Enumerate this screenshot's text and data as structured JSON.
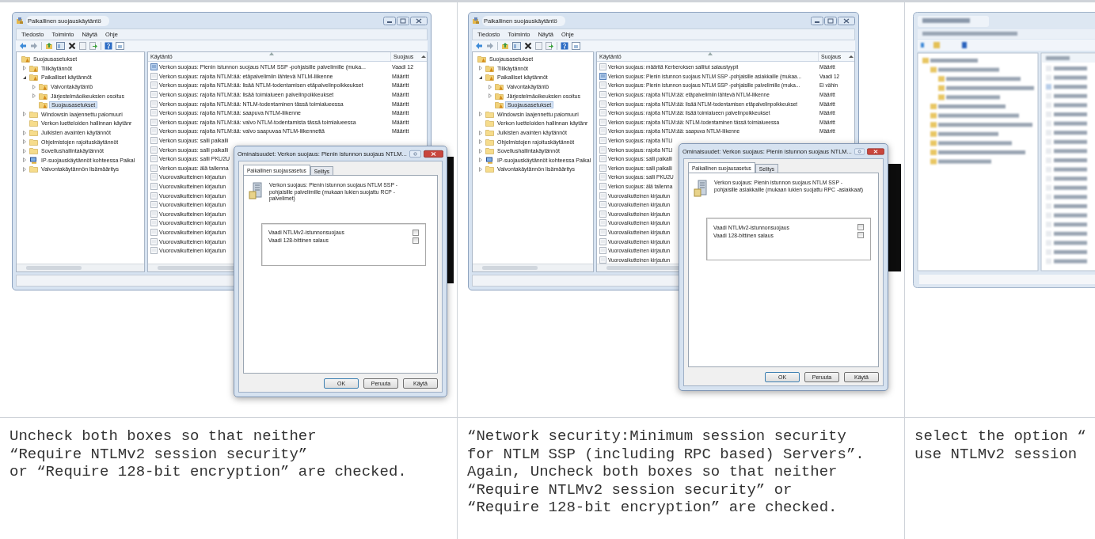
{
  "columns": [
    {
      "screenshot": {
        "kind": "window",
        "title": "Paikallinen suojauskäytäntö",
        "menu": [
          "Tiedosto",
          "Toiminto",
          "Näytä",
          "Ohje"
        ],
        "tree": [
          {
            "label": "Suojausasetukset",
            "kind": "secure-folder",
            "selected": false,
            "children": [
              {
                "label": "Tilikäytännöt",
                "kind": "secure-folder",
                "expanded": false,
                "selected": false
              },
              {
                "label": "Paikalliset käytännöt",
                "kind": "secure-folder",
                "expanded": true,
                "selected": false,
                "children": [
                  {
                    "label": "Valvontakäytäntö",
                    "kind": "secure-folder",
                    "expanded": false,
                    "selected": false
                  },
                  {
                    "label": "Järjestelmäoikeuksien osoitus",
                    "kind": "secure-folder",
                    "expanded": false,
                    "selected": false
                  },
                  {
                    "label": "Suojausasetukset",
                    "kind": "secure-folder",
                    "selected": true
                  }
                ]
              },
              {
                "label": "Windowsin laajennettu palomuuri",
                "kind": "folder",
                "expanded": false,
                "selected": false
              },
              {
                "label": "Verkon luetteloiden hallinnan käytänr",
                "kind": "folder",
                "selected": false
              },
              {
                "label": "Julkisten avainten käytännöt",
                "kind": "folder",
                "expanded": false,
                "selected": false
              },
              {
                "label": "Ohjelmistojen rajoituskäytännöt",
                "kind": "folder",
                "expanded": false,
                "selected": false
              },
              {
                "label": "Sovellushallintakäytännöt",
                "kind": "folder",
                "expanded": false,
                "selected": false
              },
              {
                "label": "IP-suojauskäytännöt kohteessa Paikal",
                "kind": "computer",
                "expanded": false,
                "selected": false
              },
              {
                "label": "Valvontakäytännön lisämääritys",
                "kind": "folder",
                "expanded": false,
                "selected": false
              }
            ]
          }
        ],
        "list": {
          "columns": [
            "Käytäntö",
            "Suojaus"
          ],
          "rows": [
            {
              "policy": "Verkon suojaus: Pienin istunnon suojaus NTLM SSP -pohjaisille palvelimille (muka...",
              "setting": "Vaadi 12",
              "highlighted": true
            },
            {
              "policy": "Verkon suojaus: rajoita NTLM:ää: etäpalvelimiin lähtevä NTLM-liikenne",
              "setting": "Määritt",
              "highlighted": false
            },
            {
              "policy": "Verkon suojaus: rajoita NTLM:ää: lisää NTLM-todentamisen etäpalvelinpoikkeukset",
              "setting": "Määritt",
              "highlighted": false
            },
            {
              "policy": "Verkon suojaus: rajoita NTLM:ää: lisää toimialueen palvelinpoikkeukset",
              "setting": "Määritt",
              "highlighted": false
            },
            {
              "policy": "Verkon suojaus: rajoita NTLM:ää: NTLM-todentaminen tässä toimialueessa",
              "setting": "Määritt",
              "highlighted": false
            },
            {
              "policy": "Verkon suojaus: rajoita NTLM:ää: saapuva NTLM-liikenne",
              "setting": "Määritt",
              "highlighted": false
            },
            {
              "policy": "Verkon suojaus: rajoita NTLM:ää: valvo NTLM-todentamista tässä toimialueessa",
              "setting": "Määritt",
              "highlighted": false
            },
            {
              "policy": "Verkon suojaus: rajoita NTLM:ää: valvo saapuvaa NTLM-liikennettä",
              "setting": "Määritt",
              "highlighted": false
            },
            {
              "policy": "Verkon suojaus: salli paikalli",
              "highlighted": false
            },
            {
              "policy": "Verkon suojaus: salli paikalli",
              "highlighted": false
            },
            {
              "policy": "Verkon suojaus: salli PKU2U",
              "highlighted": false
            },
            {
              "policy": "Verkon suojaus: älä tallenna",
              "highlighted": false
            },
            {
              "policy": "Vuorovaikutteinen kirjautun",
              "highlighted": false
            },
            {
              "policy": "Vuorovaikutteinen kirjautun",
              "highlighted": false
            },
            {
              "policy": "Vuorovaikutteinen kirjautun",
              "highlighted": false
            },
            {
              "policy": "Vuorovaikutteinen kirjautun",
              "highlighted": false
            },
            {
              "policy": "Vuorovaikutteinen kirjautun",
              "highlighted": false
            },
            {
              "policy": "Vuorovaikutteinen kirjautun",
              "highlighted": false
            },
            {
              "policy": "Vuorovaikutteinen kirjautun",
              "highlighted": false
            },
            {
              "policy": "Vuorovaikutteinen kirjautun",
              "highlighted": false
            },
            {
              "policy": "Vuorovaikutteinen kirjautun",
              "highlighted": false
            }
          ]
        },
        "console": true,
        "dialog": {
          "title": "Ominaisuudet: Verkon suojaus: Pienin istunnon suojaus NTLM...",
          "tabs": [
            {
              "label": "Paikallinen suojausasetus",
              "selected": true
            },
            {
              "label": "Selitys",
              "selected": false
            }
          ],
          "description": "Verkon suojaus: Pienin istunnon suojaus NTLM SSP -pohjaisille palvelimille (mukaan lukien suojattu RCP -palvelimet)",
          "options": [
            {
              "label": "Vaadi NTLMv2-istunnonsuojaus",
              "checked": false
            },
            {
              "label": "Vaadi 128-bittinen salaus",
              "checked": false
            }
          ],
          "buttons": [
            "OK",
            "Peruuta",
            "Käytä"
          ]
        }
      },
      "caption": "Uncheck both boxes so that neither\n“Require NTLMv2 session security”\nor “Require 128-bit encryption” are checked."
    },
    {
      "screenshot": {
        "kind": "window",
        "title": "Paikallinen suojauskäytäntö",
        "menu": [
          "Tiedosto",
          "Toiminto",
          "Näytä",
          "Ohje"
        ],
        "tree": [
          {
            "label": "Suojausasetukset",
            "kind": "secure-folder",
            "selected": false,
            "children": [
              {
                "label": "Tilikäytännöt",
                "kind": "secure-folder",
                "expanded": false,
                "selected": false
              },
              {
                "label": "Paikalliset käytännöt",
                "kind": "secure-folder",
                "expanded": true,
                "selected": false,
                "children": [
                  {
                    "label": "Valvontakäytäntö",
                    "kind": "secure-folder",
                    "expanded": false,
                    "selected": false
                  },
                  {
                    "label": "Järjestelmäoikeuksien osoitus",
                    "kind": "secure-folder",
                    "expanded": false,
                    "selected": false
                  },
                  {
                    "label": "Suojausasetukset",
                    "kind": "secure-folder",
                    "selected": true
                  }
                ]
              },
              {
                "label": "Windowsin laajennettu palomuuri",
                "kind": "folder",
                "expanded": false,
                "selected": false
              },
              {
                "label": "Verkon luetteloiden hallinnan käytänr",
                "kind": "folder",
                "selected": false
              },
              {
                "label": "Julkisten avainten käytännöt",
                "kind": "folder",
                "expanded": false,
                "selected": false
              },
              {
                "label": "Ohjelmistojen rajoituskäytännöt",
                "kind": "folder",
                "expanded": false,
                "selected": false
              },
              {
                "label": "Sovellushallintakäytännöt",
                "kind": "folder",
                "expanded": false,
                "selected": false
              },
              {
                "label": "IP-suojauskäytännöt kohteessa Paikal",
                "kind": "computer",
                "expanded": false,
                "selected": false
              },
              {
                "label": "Valvontakäytännön lisämääritys",
                "kind": "folder",
                "expanded": false,
                "selected": false
              }
            ]
          }
        ],
        "list": {
          "columns": [
            "Käytäntö",
            "Suojaus"
          ],
          "rows": [
            {
              "policy": "Verkon suojaus: määritä Kerberoksen sallitut salaustyypit",
              "setting": "Määritt",
              "highlighted": false
            },
            {
              "policy": "Verkon suojaus: Pienin istunnon suojaus NTLM SSP -pohjaisille asiakkaille (mukaa...",
              "setting": "Vaadi 12",
              "highlighted": true
            },
            {
              "policy": "Verkon suojaus: Pienin istunnon suojaus NTLM SSP -pohjaisille palvelimille (muka...",
              "setting": "Ei vähin",
              "highlighted": false
            },
            {
              "policy": "Verkon suojaus: rajoita NTLM:ää: etäpalvelimiin lähtevä NTLM-liikenne",
              "setting": "Määritt",
              "highlighted": false
            },
            {
              "policy": "Verkon suojaus: rajoita NTLM:ää: lisää NTLM-todentamisen etäpalvelinpoikkeukset",
              "setting": "Määritt",
              "highlighted": false
            },
            {
              "policy": "Verkon suojaus: rajoita NTLM:ää: lisää toimialueen palvelinpoikkeukset",
              "setting": "Määritt",
              "highlighted": false
            },
            {
              "policy": "Verkon suojaus: rajoita NTLM:ää: NTLM-todentaminen tässä toimialueessa",
              "setting": "Määritt",
              "highlighted": false
            },
            {
              "policy": "Verkon suojaus: rajoita NTLM:ää: saapuva NTLM-liikenne",
              "setting": "Määritt",
              "highlighted": false
            },
            {
              "policy": "Verkon suojaus: rajoita NTLI",
              "highlighted": false
            },
            {
              "policy": "Verkon suojaus: rajoita NTLI",
              "highlighted": false
            },
            {
              "policy": "Verkon suojaus: salli paikalli",
              "highlighted": false
            },
            {
              "policy": "Verkon suojaus: salli paikalli",
              "highlighted": false
            },
            {
              "policy": "Verkon suojaus: salli PKU2U",
              "highlighted": false
            },
            {
              "policy": "Verkon suojaus: älä tallenna",
              "highlighted": false
            },
            {
              "policy": "Vuorovaikutteinen kirjautun",
              "highlighted": false
            },
            {
              "policy": "Vuorovaikutteinen kirjautun",
              "highlighted": false
            },
            {
              "policy": "Vuorovaikutteinen kirjautun",
              "highlighted": false
            },
            {
              "policy": "Vuorovaikutteinen kirjautun",
              "highlighted": false
            },
            {
              "policy": "Vuorovaikutteinen kirjautun",
              "highlighted": false
            },
            {
              "policy": "Vuorovaikutteinen kirjautun",
              "highlighted": false
            },
            {
              "policy": "Vuorovaikutteinen kirjautun",
              "highlighted": false
            },
            {
              "policy": "Vuorovaikutteinen kirjautun",
              "highlighted": false
            }
          ]
        },
        "console": true,
        "dialog": {
          "title": "Ominaisuudet: Verkon suojaus: Pienin istunnon suojaus NTLM...",
          "tabs": [
            {
              "label": "Paikallinen suojausasetus",
              "selected": true
            },
            {
              "label": "Selitys",
              "selected": false
            }
          ],
          "description": "Verkon suojaus: Pienin istunnon suojaus NTLM SSP -pohjaisille asiakkaille (mukaan lukien suojattu RPC -asiakkaat)",
          "options": [
            {
              "label": "Vaadi NTLMv2-istunnonsuojaus",
              "checked": false
            },
            {
              "label": "Vaadi 128-bittinen salaus",
              "checked": false
            }
          ],
          "buttons": [
            "OK",
            "Peruuta",
            "Käytä"
          ]
        }
      },
      "caption": "“Network security:Minimum session security\nfor NTLM SSP (including RPC based) Servers”.\nAgain, Uncheck both boxes so that neither\n“Require NTLMv2 session security” or\n“Require 128-bit encryption” are checked."
    },
    {
      "screenshot": {
        "kind": "blurred"
      },
      "caption": "select the option “\nuse NTLMv2 session"
    }
  ]
}
